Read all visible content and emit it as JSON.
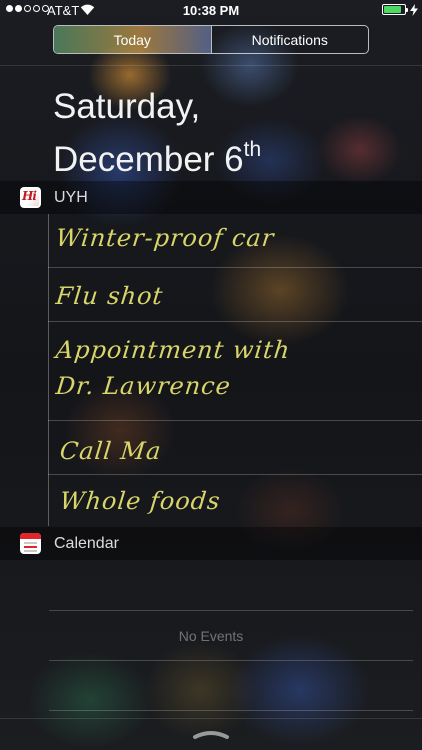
{
  "status_bar": {
    "signal_dots_filled": 2,
    "signal_dots_total": 5,
    "carrier": "AT&T",
    "wifi_icon": "wifi-icon",
    "time": "10:38 PM",
    "battery_level": 0.85,
    "battery_color": "#4cd964",
    "charging_icon": "bolt-icon"
  },
  "segmented_control": {
    "tabs": [
      {
        "label": "Today",
        "selected": true
      },
      {
        "label": "Notifications",
        "selected": false
      }
    ]
  },
  "header": {
    "weekday_line": "Saturday,",
    "date_line": "December 6",
    "date_suffix": "th"
  },
  "widgets": {
    "uyh": {
      "title": "UYH",
      "icon": "uyh-app-icon",
      "icon_text": "Hi",
      "notes": [
        {
          "lines": [
            "Winter-proof car"
          ]
        },
        {
          "lines": [
            "Flu shot"
          ]
        },
        {
          "lines": [
            "Appointment with",
            "Dr. Lawrence"
          ]
        },
        {
          "lines": [
            "Call Ma"
          ]
        },
        {
          "lines": [
            "Whole foods"
          ]
        }
      ],
      "ink_color": "#d9d56a"
    },
    "calendar": {
      "title": "Calendar",
      "icon": "calendar-app-icon",
      "empty_text": "No Events"
    }
  },
  "footer": {
    "handle_icon": "chevron-up-handle-icon"
  }
}
